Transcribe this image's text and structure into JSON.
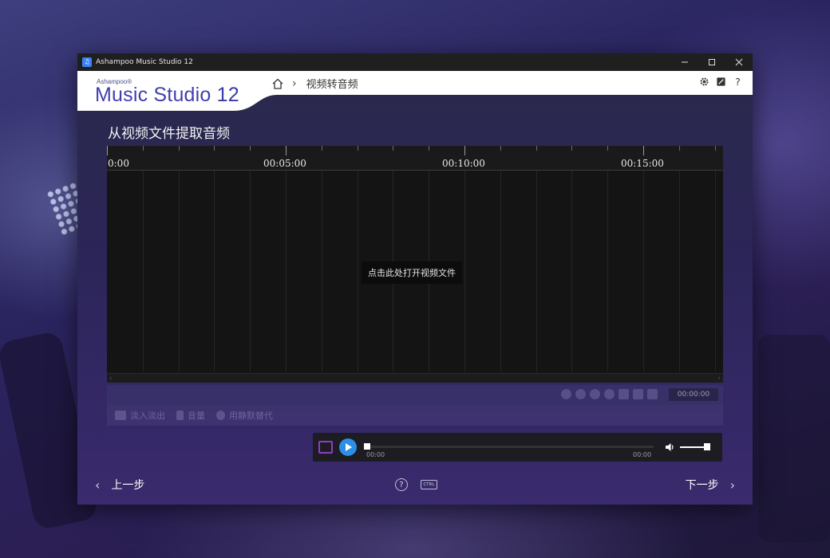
{
  "window": {
    "title": "Ashampoo Music Studio 12",
    "minimize_icon": "minimize-icon",
    "maximize_icon": "maximize-icon",
    "close_icon": "close-icon"
  },
  "header": {
    "logo_small": "Ashampoo®",
    "logo_text": "Music Studio",
    "logo_version": "12",
    "breadcrumb_current": "视频转音频",
    "tools": [
      "gear-icon",
      "edit-icon",
      "help-icon"
    ],
    "help_label": "?"
  },
  "page": {
    "title": "从视频文件提取音频"
  },
  "timeline": {
    "labels": [
      "0:00",
      "00:05:00",
      "00:10:00",
      "00:15:00"
    ],
    "open_hint": "点击此处打开视频文件"
  },
  "edit_toolbar": {
    "time": "00:00:00"
  },
  "effects": {
    "fade": "淡入淡出",
    "volume": "音量",
    "silence": "用静默替代"
  },
  "player": {
    "time_start": "00:00",
    "time_end": "00:00",
    "colors": {
      "accent": "#2d8ee6",
      "loop": "#8a3ec8"
    }
  },
  "nav": {
    "prev": "上一步",
    "next": "下一步",
    "help": "?",
    "ctrl": "CTRL"
  }
}
